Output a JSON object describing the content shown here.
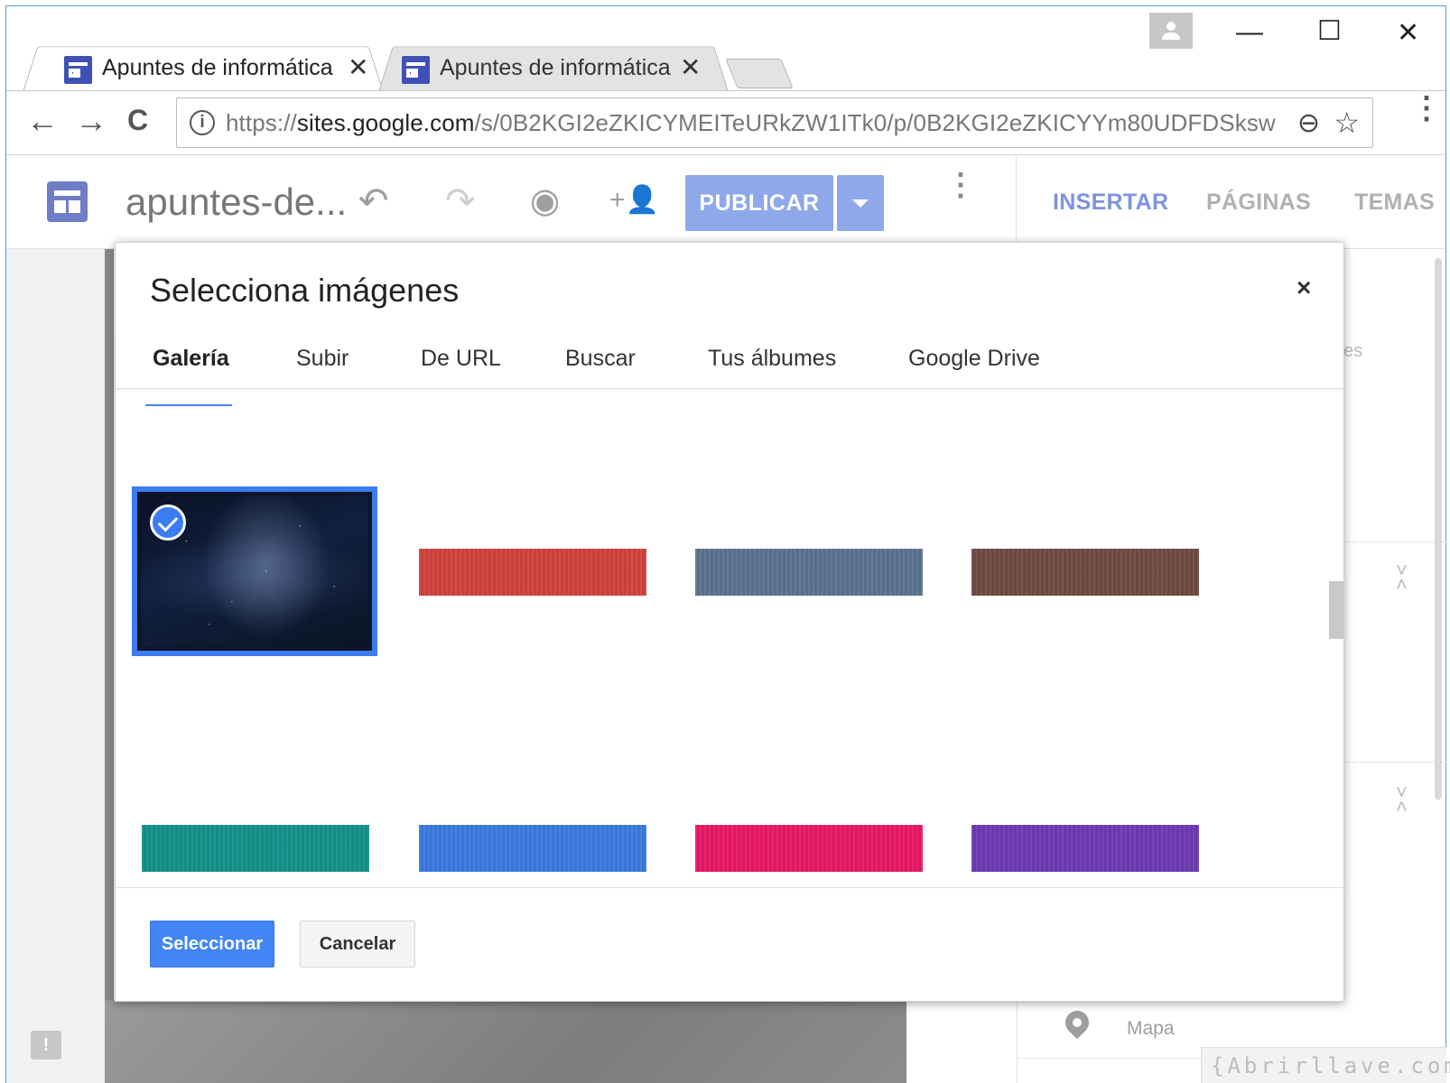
{
  "browser": {
    "tabs": [
      {
        "title": "Apuntes de informática",
        "close": "✕"
      },
      {
        "title": "Apuntes de informática",
        "close": "✕"
      }
    ],
    "window_controls": {
      "minimize": "—",
      "maximize": "☐",
      "close": "✕"
    },
    "nav": {
      "back": "←",
      "forward": "→",
      "reload": "C"
    },
    "url_scheme": "https://",
    "url_domain": "sites.google.com",
    "url_path": "/s/0B2KGI2eZKICYMEITeURkZW1ITk0/p/0B2KGI2eZKICYYm80UDFDSksw",
    "zoom_glyph": "⊖",
    "star_glyph": "☆",
    "menu_glyph": "⋮"
  },
  "appbar": {
    "site_name": "apuntes-de...",
    "undo_glyph": "↶",
    "redo_glyph": "↷",
    "preview_glyph": "◉",
    "share_glyph": "+👤",
    "publish_label": "PUBLICAR",
    "more_glyph": "⋮",
    "side_tabs": [
      {
        "label": "INSERTAR",
        "color": "#7c93de"
      },
      {
        "label": "PÁGINAS",
        "color": "#b0b0b0"
      },
      {
        "label": "TEMAS",
        "color": "#b0b0b0"
      }
    ]
  },
  "dialog": {
    "title": "Selecciona imágenes",
    "close_glyph": "×",
    "tabs": [
      "Galería",
      "Subir",
      "De URL",
      "Buscar",
      "Tus álbumes",
      "Google Drive"
    ],
    "active_tab": "Galería",
    "swatches": [
      {
        "color": "#d0423c"
      },
      {
        "color": "#5b7290"
      },
      {
        "color": "#6e4a42"
      },
      {
        "color": "#13918a"
      },
      {
        "color": "#3b7ae0"
      },
      {
        "color": "#e81865"
      },
      {
        "color": "#6c3ab3"
      }
    ],
    "select_label": "Seleccionar",
    "cancel_label": "Cancelar"
  },
  "right_panel": {
    "partial_text": "es",
    "map_label": "Mapa"
  },
  "feedback_glyph": "!",
  "watermark": "{Abrirllave.com"
}
